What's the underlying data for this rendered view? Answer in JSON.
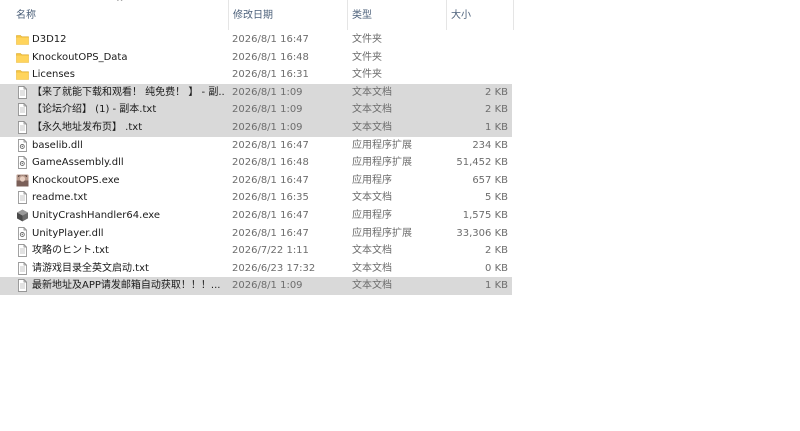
{
  "columns": {
    "name": "名称",
    "date": "修改日期",
    "type": "类型",
    "size": "大小"
  },
  "sort_arrow": "^",
  "files": [
    {
      "name": "D3D12",
      "date": "2026/8/1 16:47",
      "type": "文件夹",
      "size": "",
      "icon": "folder-icon",
      "selected": false
    },
    {
      "name": "KnockoutOPS_Data",
      "date": "2026/8/1 16:48",
      "type": "文件夹",
      "size": "",
      "icon": "folder-icon",
      "selected": false
    },
    {
      "name": "Licenses",
      "date": "2026/8/1 16:31",
      "type": "文件夹",
      "size": "",
      "icon": "folder-icon",
      "selected": false
    },
    {
      "name": "【来了就能下载和观看！ 纯免费！ 】 - 副...",
      "date": "2026/8/1 1:09",
      "type": "文本文档",
      "size": "2 KB",
      "icon": "text-file-icon",
      "selected": true
    },
    {
      "name": "【论坛介绍】 (1) - 副本.txt",
      "date": "2026/8/1 1:09",
      "type": "文本文档",
      "size": "2 KB",
      "icon": "text-file-icon",
      "selected": true
    },
    {
      "name": "【永久地址发布页】 .txt",
      "date": "2026/8/1 1:09",
      "type": "文本文档",
      "size": "1 KB",
      "icon": "text-file-icon",
      "selected": true
    },
    {
      "name": "baselib.dll",
      "date": "2026/8/1 16:47",
      "type": "应用程序扩展",
      "size": "234 KB",
      "icon": "dll-file-icon",
      "selected": false
    },
    {
      "name": "GameAssembly.dll",
      "date": "2026/8/1 16:48",
      "type": "应用程序扩展",
      "size": "51,452 KB",
      "icon": "dll-file-icon",
      "selected": false
    },
    {
      "name": "KnockoutOPS.exe",
      "date": "2026/8/1 16:47",
      "type": "应用程序",
      "size": "657 KB",
      "icon": "app-icon",
      "selected": false
    },
    {
      "name": "readme.txt",
      "date": "2026/8/1 16:35",
      "type": "文本文档",
      "size": "5 KB",
      "icon": "text-file-icon",
      "selected": false
    },
    {
      "name": "UnityCrashHandler64.exe",
      "date": "2026/8/1 16:47",
      "type": "应用程序",
      "size": "1,575 KB",
      "icon": "unity-icon",
      "selected": false
    },
    {
      "name": "UnityPlayer.dll",
      "date": "2026/8/1 16:47",
      "type": "应用程序扩展",
      "size": "33,306 KB",
      "icon": "dll-file-icon",
      "selected": false
    },
    {
      "name": "攻略のヒント.txt",
      "date": "2026/7/22 1:11",
      "type": "文本文档",
      "size": "2 KB",
      "icon": "text-file-icon",
      "selected": false
    },
    {
      "name": "请游戏目录全英文启动.txt",
      "date": "2026/6/23 17:32",
      "type": "文本文档",
      "size": "0 KB",
      "icon": "text-file-icon",
      "selected": false
    },
    {
      "name": "最新地址及APP请发邮箱自动获取！！！...",
      "date": "2026/8/1 1:09",
      "type": "文本文档",
      "size": "1 KB",
      "icon": "text-file-icon",
      "selected": true
    }
  ],
  "colors": {
    "selected_row": "#d9d9d9",
    "folder": "#f5c542",
    "header_text": "#4c607a"
  }
}
